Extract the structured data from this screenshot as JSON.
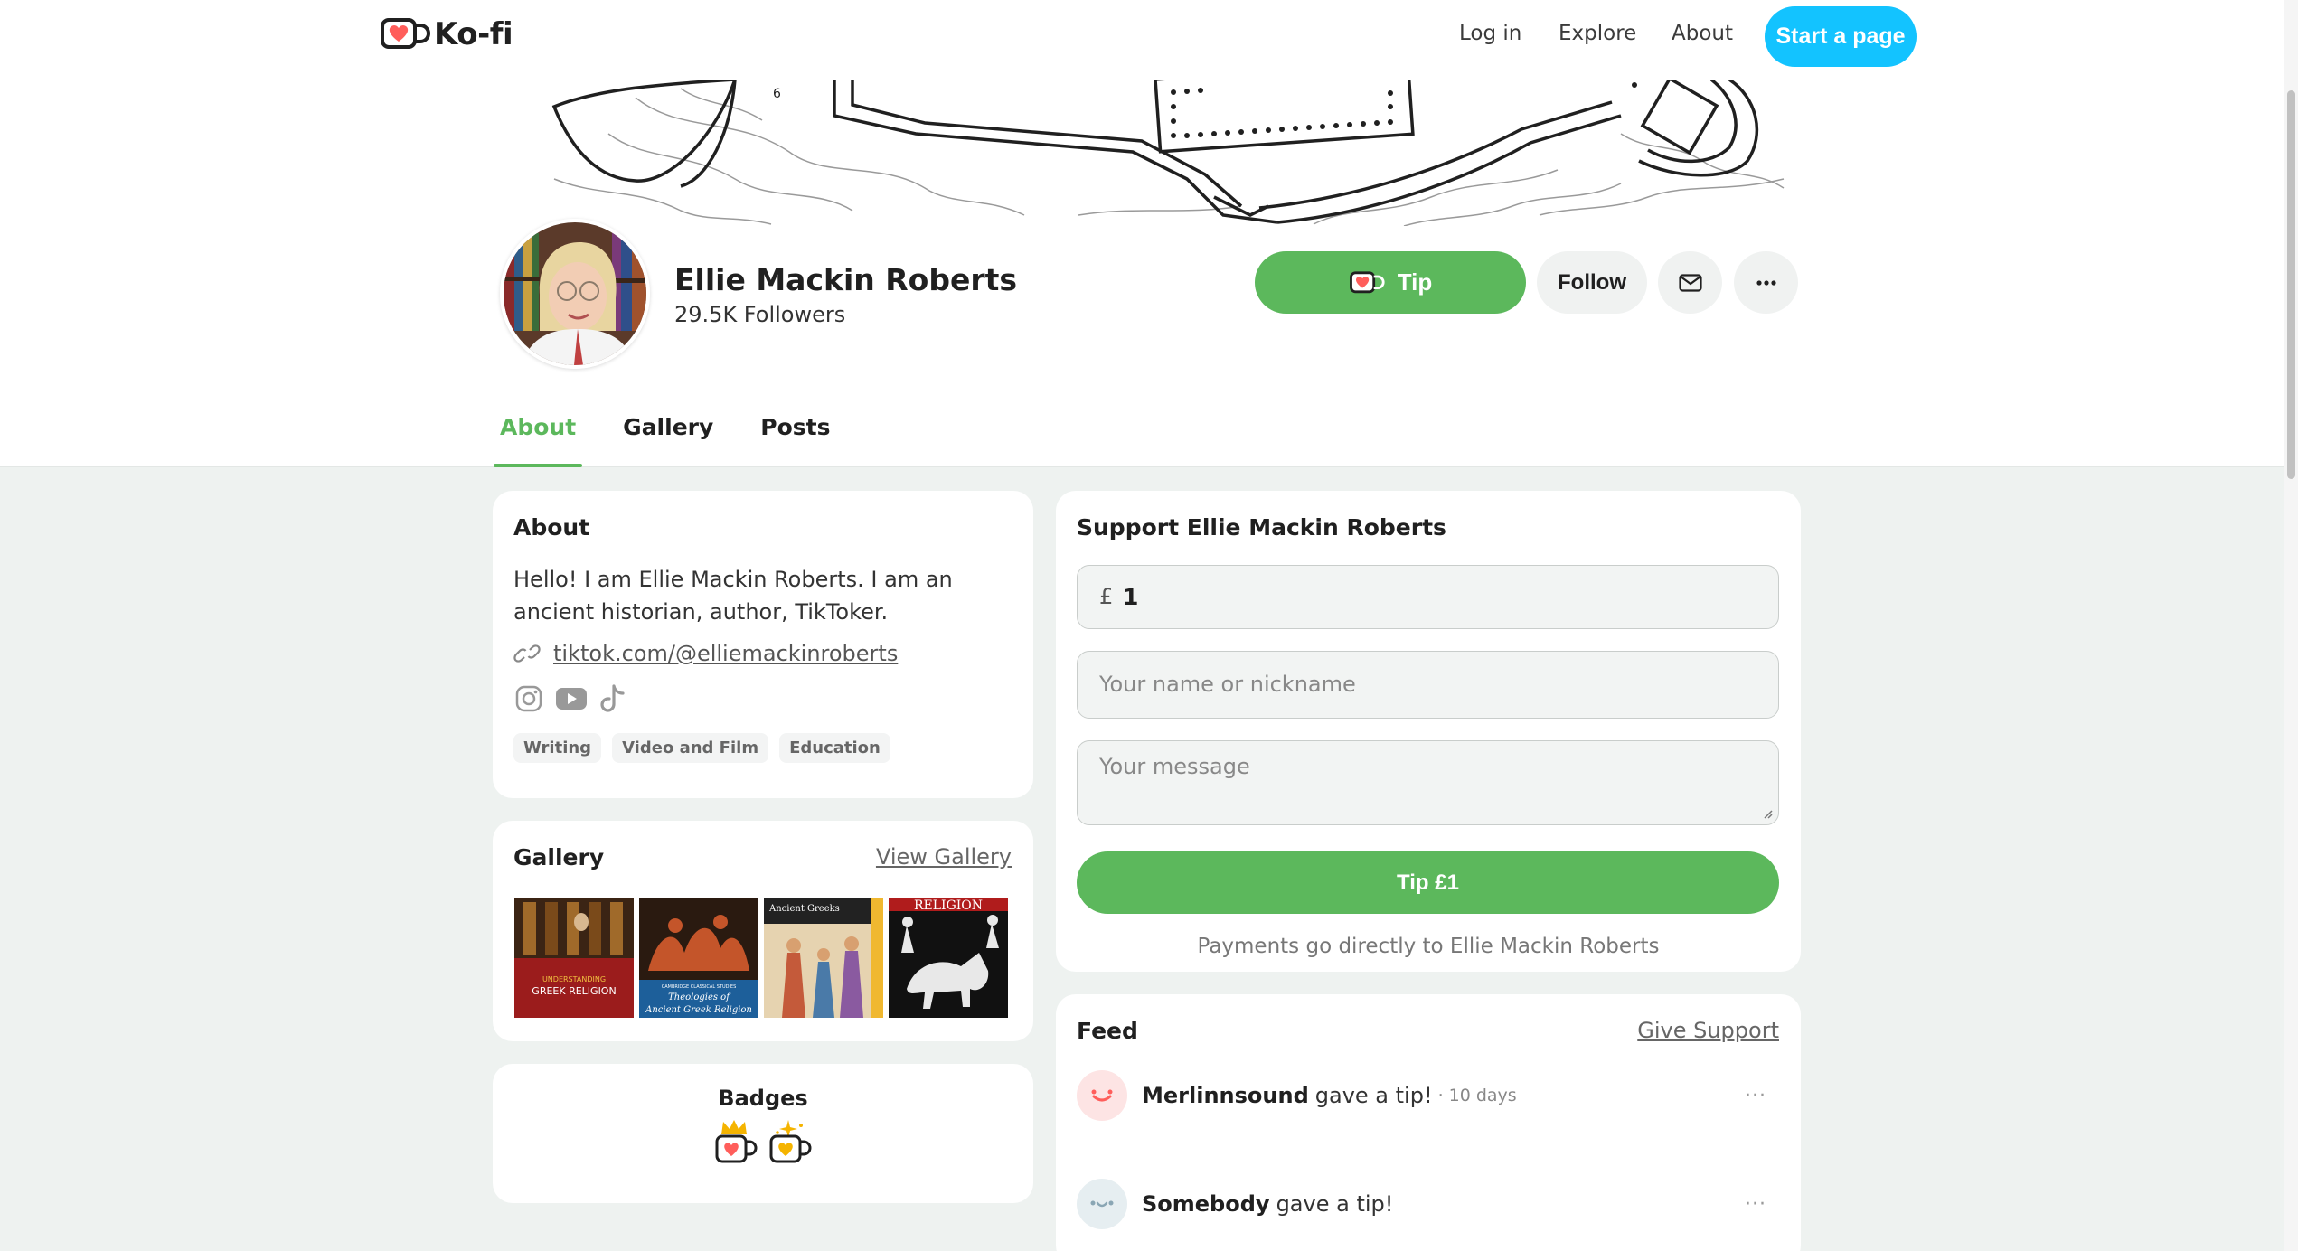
{
  "nav": {
    "logo_text": "Ko-fi",
    "login": "Log in",
    "explore": "Explore",
    "about": "About",
    "start_page": "Start a page"
  },
  "profile": {
    "name": "Ellie Mackin Roberts",
    "followers": "29.5K Followers",
    "tip_label": "Tip",
    "follow_label": "Follow"
  },
  "tabs": [
    {
      "label": "About",
      "active": true
    },
    {
      "label": "Gallery",
      "active": false
    },
    {
      "label": "Posts",
      "active": false
    }
  ],
  "about_card": {
    "title": "About",
    "bio": "Hello! I am Ellie Mackin Roberts. I am an ancient historian, author, TikToker.",
    "link": "tiktok.com/@elliemackinroberts",
    "socials": [
      "instagram-icon",
      "youtube-icon",
      "tiktok-icon"
    ],
    "tags": [
      "Writing",
      "Video and Film",
      "Education"
    ]
  },
  "gallery_card": {
    "title": "Gallery",
    "view_link": "View Gallery",
    "items": [
      {
        "line1": "UNDERSTANDING",
        "line2": "GREEK RELIGION"
      },
      {
        "line1": "CAMBRIDGE CLASSICAL STUDIES",
        "line2": "Theologies of",
        "line3": "Ancient Greek Religion"
      },
      {
        "line1": "Ancient Greeks"
      },
      {
        "line1": "RELIGION"
      }
    ]
  },
  "badges_card": {
    "title": "Badges"
  },
  "support_card": {
    "title": "Support Ellie Mackin Roberts",
    "currency": "£",
    "amount": "1",
    "name_placeholder": "Your name or nickname",
    "message_placeholder": "Your message",
    "submit_label": "Tip £1",
    "note": "Payments go directly to Ellie Mackin Roberts"
  },
  "feed_card": {
    "title": "Feed",
    "give_support": "Give Support",
    "items": [
      {
        "name": "Merlinnsound",
        "action": "gave a tip!",
        "time": "· 10 days",
        "more": "···"
      },
      {
        "name": "Somebody",
        "action": "gave a tip!",
        "time": "",
        "more": "···"
      }
    ]
  },
  "colors": {
    "accent_green": "#5cb85c",
    "brand_blue": "#13c3ff",
    "page_bg": "#eef2f0"
  }
}
